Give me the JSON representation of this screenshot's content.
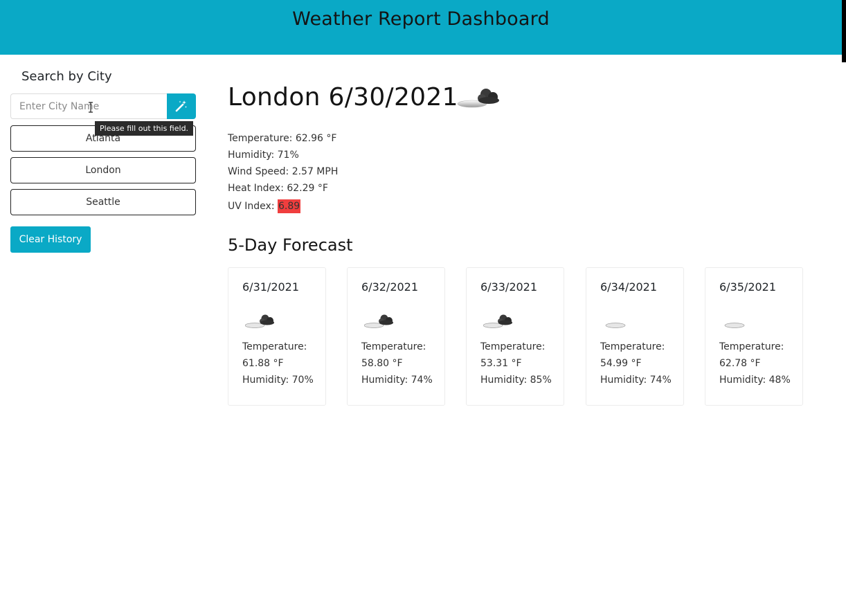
{
  "header": {
    "title": "Weather Report Dashboard"
  },
  "colors": {
    "accent": "#0aa9c6",
    "uv_severe": "#f03e3e"
  },
  "sidebar": {
    "heading": "Search by City",
    "search_placeholder": "Enter City Name",
    "search_icon": "magic-wand-icon",
    "validation_tooltip": "Please fill out this field.",
    "history": [
      "Atlanta",
      "London",
      "Seattle"
    ],
    "clear_label": "Clear History"
  },
  "current": {
    "title": "London 6/30/2021",
    "icon": "partly-cloudy-icon",
    "temperature": "Temperature: 62.96 °F",
    "humidity": "Humidity: 71%",
    "wind": "Wind Speed: 2.57 MPH",
    "heat_index": "Heat Index: 62.29 °F",
    "uv_label": "UV Index: ",
    "uv_value": "6.89"
  },
  "forecast": {
    "heading": "5-Day Forecast",
    "days": [
      {
        "date": "6/31/2021",
        "icon": "partly-cloudy-icon",
        "temp_label": "Temperature:",
        "temp_value": "61.88 °F",
        "humidity": "Humidity: 70%"
      },
      {
        "date": "6/32/2021",
        "icon": "partly-cloudy-icon",
        "temp_label": "Temperature:",
        "temp_value": "58.80 °F",
        "humidity": "Humidity: 74%"
      },
      {
        "date": "6/33/2021",
        "icon": "partly-cloudy-icon",
        "temp_label": "Temperature:",
        "temp_value": "53.31 °F",
        "humidity": "Humidity: 85%"
      },
      {
        "date": "6/34/2021",
        "icon": "cloud-icon",
        "temp_label": "Temperature:",
        "temp_value": "54.99 °F",
        "humidity": "Humidity: 74%"
      },
      {
        "date": "6/35/2021",
        "icon": "cloud-icon",
        "temp_label": "Temperature:",
        "temp_value": "62.78 °F",
        "humidity": "Humidity: 48%"
      }
    ]
  }
}
